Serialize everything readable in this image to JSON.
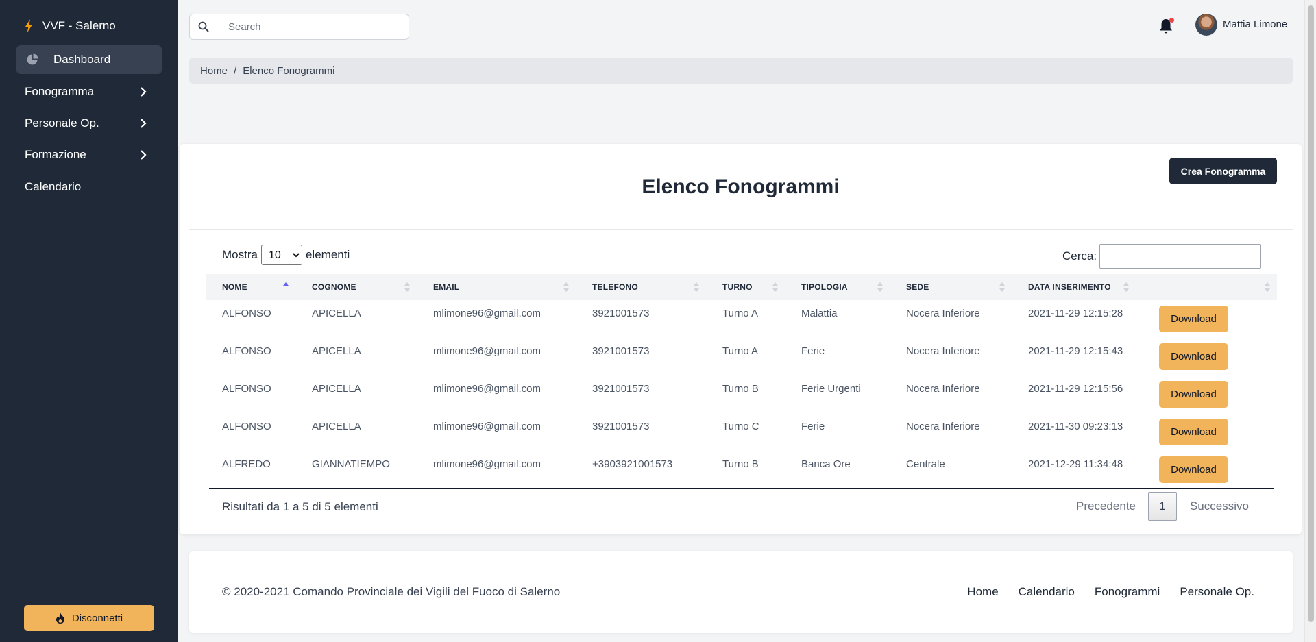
{
  "brand": {
    "name": "VVF - Salerno"
  },
  "sidebar": {
    "items": [
      {
        "label": "Dashboard",
        "icon": "pie-chart-icon",
        "active": true
      },
      {
        "label": "Fonogramma",
        "icon": "chevron-right-icon"
      },
      {
        "label": "Personale Op.",
        "icon": "chevron-right-icon"
      },
      {
        "label": "Formazione",
        "icon": "chevron-right-icon"
      },
      {
        "label": "Calendario"
      }
    ],
    "logout_label": "Disconnetti"
  },
  "topbar": {
    "search_placeholder": "Search",
    "user_name": "Mattia Limone"
  },
  "breadcrumb": {
    "home": "Home",
    "separator": "/",
    "current": "Elenco Fonogrammi"
  },
  "page": {
    "title": "Elenco Fonogrammi",
    "create_label": "Crea Fonogramma",
    "length_prefix": "Mostra",
    "length_value": "10",
    "length_suffix": "elementi",
    "filter_label": "Cerca:",
    "info": "Risultati da 1 a 5 di 5 elementi",
    "prev_label": "Precedente",
    "current_page": "1",
    "next_label": "Successivo"
  },
  "table": {
    "headers": [
      "NOME",
      "COGNOME",
      "EMAIL",
      "TELEFONO",
      "TURNO",
      "TIPOLOGIA",
      "SEDE",
      "DATA INSERIMENTO",
      ""
    ],
    "download_label": "Download",
    "rows": [
      [
        "ALFONSO",
        "APICELLA",
        "mlimone96@gmail.com",
        "3921001573",
        "Turno A",
        "Malattia",
        "Nocera Inferiore",
        "2021-11-29 12:15:28"
      ],
      [
        "ALFONSO",
        "APICELLA",
        "mlimone96@gmail.com",
        "3921001573",
        "Turno A",
        "Ferie",
        "Nocera Inferiore",
        "2021-11-29 12:15:43"
      ],
      [
        "ALFONSO",
        "APICELLA",
        "mlimone96@gmail.com",
        "3921001573",
        "Turno B",
        "Ferie Urgenti",
        "Nocera Inferiore",
        "2021-11-29 12:15:56"
      ],
      [
        "ALFONSO",
        "APICELLA",
        "mlimone96@gmail.com",
        "3921001573",
        "Turno C",
        "Ferie",
        "Nocera Inferiore",
        "2021-11-30 09:23:13"
      ],
      [
        "ALFREDO",
        "GIANNATIEMPO",
        "mlimone96@gmail.com",
        "+3903921001573",
        "Turno B",
        "Banca Ore",
        "Centrale",
        "2021-12-29 11:34:48"
      ]
    ]
  },
  "footer": {
    "copyright": "© 2020-2021 Comando Provinciale dei Vigili del Fuoco di Salerno",
    "links": [
      "Home",
      "Calendario",
      "Fonogrammi",
      "Personale Op."
    ]
  },
  "colors": {
    "sidebar": "#1f2937",
    "accent": "#f1b45a",
    "primary_button": "#1f2937",
    "notification_dot": "#ef4444"
  }
}
